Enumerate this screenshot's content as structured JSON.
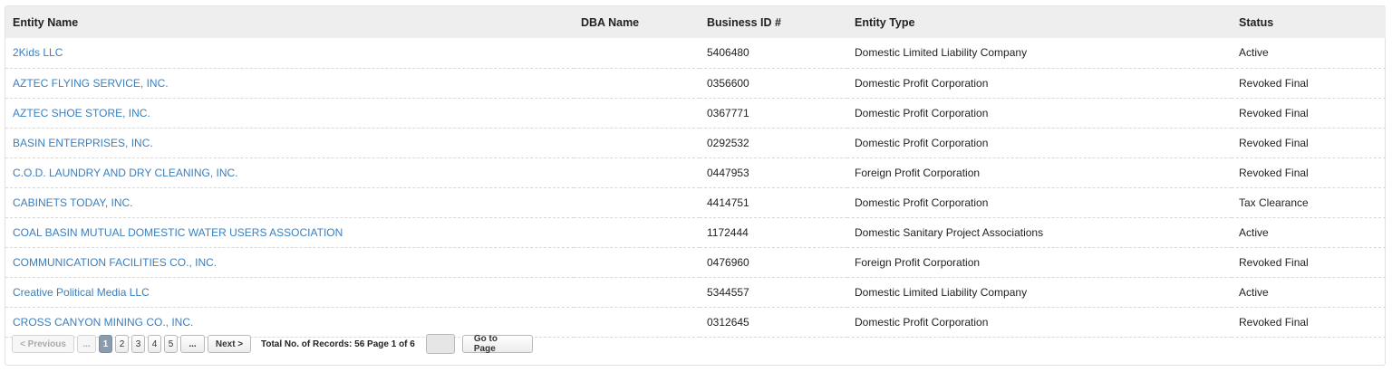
{
  "table": {
    "headers": {
      "entity_name": "Entity Name",
      "dba_name": "DBA Name",
      "business_id": "Business ID #",
      "entity_type": "Entity Type",
      "status": "Status"
    },
    "rows": [
      {
        "name": "2Kids LLC",
        "dba": "",
        "id": "5406480",
        "type": "Domestic Limited Liability Company",
        "status": "Active"
      },
      {
        "name": "AZTEC FLYING SERVICE, INC.",
        "dba": "",
        "id": "0356600",
        "type": "Domestic Profit Corporation",
        "status": "Revoked Final"
      },
      {
        "name": "AZTEC SHOE STORE, INC.",
        "dba": "",
        "id": "0367771",
        "type": "Domestic Profit Corporation",
        "status": "Revoked Final"
      },
      {
        "name": "BASIN ENTERPRISES, INC.",
        "dba": "",
        "id": "0292532",
        "type": "Domestic Profit Corporation",
        "status": "Revoked Final"
      },
      {
        "name": "C.O.D. LAUNDRY AND DRY CLEANING, INC.",
        "dba": "",
        "id": "0447953",
        "type": "Foreign Profit Corporation",
        "status": "Revoked Final"
      },
      {
        "name": "CABINETS TODAY, INC.",
        "dba": "",
        "id": "4414751",
        "type": "Domestic Profit Corporation",
        "status": "Tax Clearance"
      },
      {
        "name": "COAL BASIN MUTUAL DOMESTIC WATER USERS ASSOCIATION",
        "dba": "",
        "id": "1172444",
        "type": "Domestic Sanitary Project Associations",
        "status": "Active"
      },
      {
        "name": "COMMUNICATION FACILITIES CO., INC.",
        "dba": "",
        "id": "0476960",
        "type": "Foreign Profit Corporation",
        "status": "Revoked Final"
      },
      {
        "name": "Creative Political Media LLC",
        "dba": "",
        "id": "5344557",
        "type": "Domestic Limited Liability Company",
        "status": "Active"
      },
      {
        "name": "CROSS CANYON MINING CO., INC.",
        "dba": "",
        "id": "0312645",
        "type": "Domestic Profit Corporation",
        "status": "Revoked Final"
      }
    ]
  },
  "pager": {
    "previous_label": "< Previous",
    "ellipsis_label": "...",
    "pages": [
      "1",
      "2",
      "3",
      "4",
      "5"
    ],
    "current_page": "1",
    "next_label": "Next >",
    "total_text": "Total No. of Records: 56 Page 1 of 6",
    "goto_value": "",
    "goto_label": "Go to Page"
  },
  "colors": {
    "link": "#3a7fbf",
    "header_bg": "#eeeeee",
    "current_page_bg": "#8a9bb0"
  }
}
